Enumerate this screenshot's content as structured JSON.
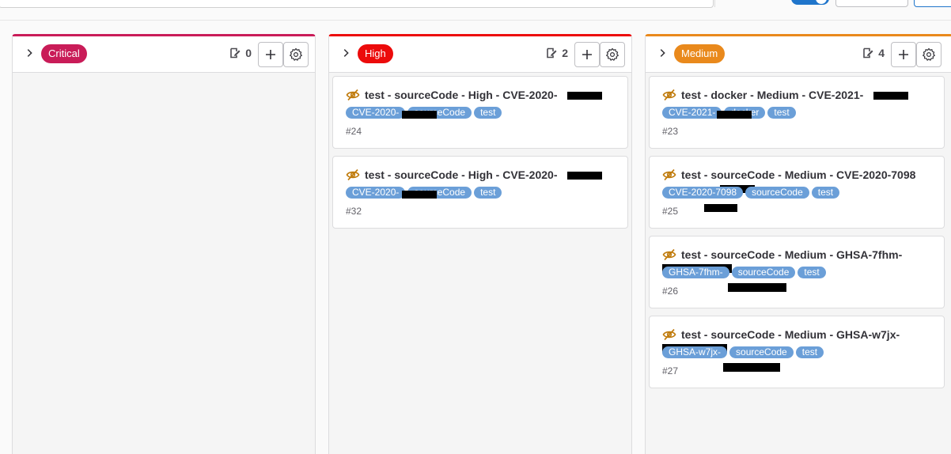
{
  "columns": [
    {
      "label": "Critical",
      "color": "#c91c58",
      "count": "0",
      "cards": []
    },
    {
      "label": "High",
      "color": "#ec0b0b",
      "count": "2",
      "cards": [
        {
          "title": "test - sourceCode - High - CVE-2020-",
          "tags": [
            "CVE-2020-",
            "sourceCode",
            "test"
          ],
          "number": "#24"
        },
        {
          "title": "test - sourceCode - High - CVE-2020-",
          "tags": [
            "CVE-2020-",
            "sourceCode",
            "test"
          ],
          "number": "#32"
        }
      ]
    },
    {
      "label": "Medium",
      "color": "#e9891c",
      "count": "4",
      "cards": [
        {
          "title": "test - docker - Medium - CVE-2021-",
          "tags": [
            "CVE-2021-",
            "docker",
            "test"
          ],
          "number": "#23"
        },
        {
          "title": "test - sourceCode - Medium - CVE-2020-7098",
          "tags": [
            "CVE-2020-7098",
            "sourceCode",
            "test"
          ],
          "number": "#25"
        },
        {
          "title": "test - sourceCode - Medium - GHSA-7fhm-",
          "tags": [
            "GHSA-7fhm-",
            "sourceCode",
            "test"
          ],
          "number": "#26"
        },
        {
          "title": "test - sourceCode - Medium - GHSA-w7jx-",
          "tags": [
            "GHSA-w7jx-",
            "sourceCode",
            "test"
          ],
          "number": "#27"
        }
      ]
    }
  ],
  "icons": {
    "collapse": "chevron-right-icon",
    "issues": "issues-icon",
    "add": "plus-icon",
    "settings": "gear-icon",
    "confidential": "eye-slash-icon"
  }
}
